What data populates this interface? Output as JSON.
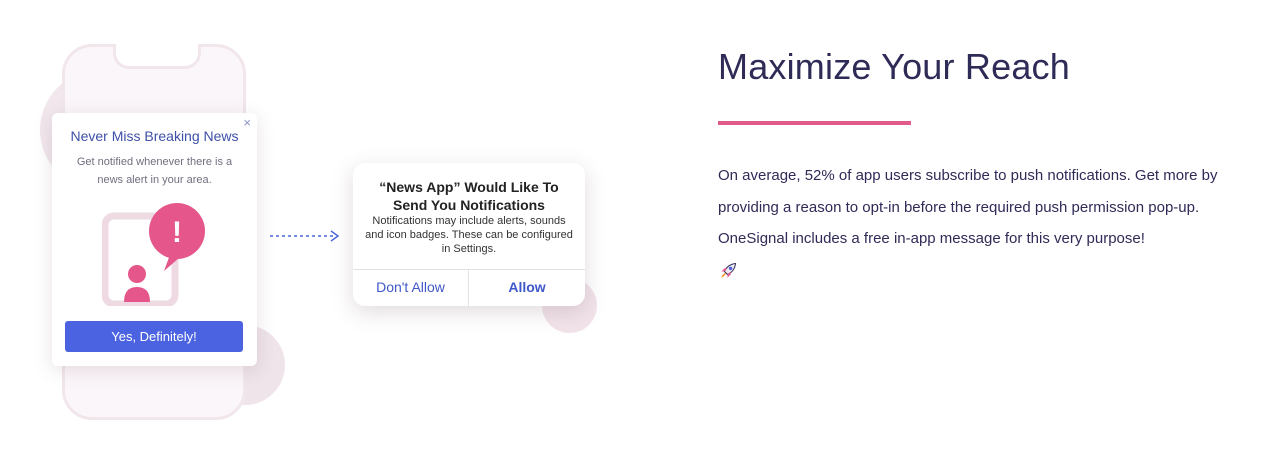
{
  "popup": {
    "close_glyph": "×",
    "title": "Never Miss Breaking News",
    "description": "Get notified whenever there is a news alert in your area.",
    "cta_label": "Yes, Definitely!",
    "alert_glyph": "!"
  },
  "system_dialog": {
    "title": "“News App” Would Like To Send You Notifications",
    "body": "Notifications may include alerts, sounds and icon badges. These can be configured in Settings.",
    "deny_label": "Don't Allow",
    "allow_label": "Allow"
  },
  "section": {
    "heading": "Maximize Your Reach",
    "paragraph": "On average, 52% of app users subscribe to push notifications. Get more by providing a reason to opt-in before the required push permission pop-up. OneSignal includes a free in-app message for this very purpose!",
    "emoji_icon": "rocket-icon"
  },
  "colors": {
    "accent_pink": "#e05a8c",
    "primary_blue": "#4b63e0",
    "heading_navy": "#2f2b57"
  }
}
